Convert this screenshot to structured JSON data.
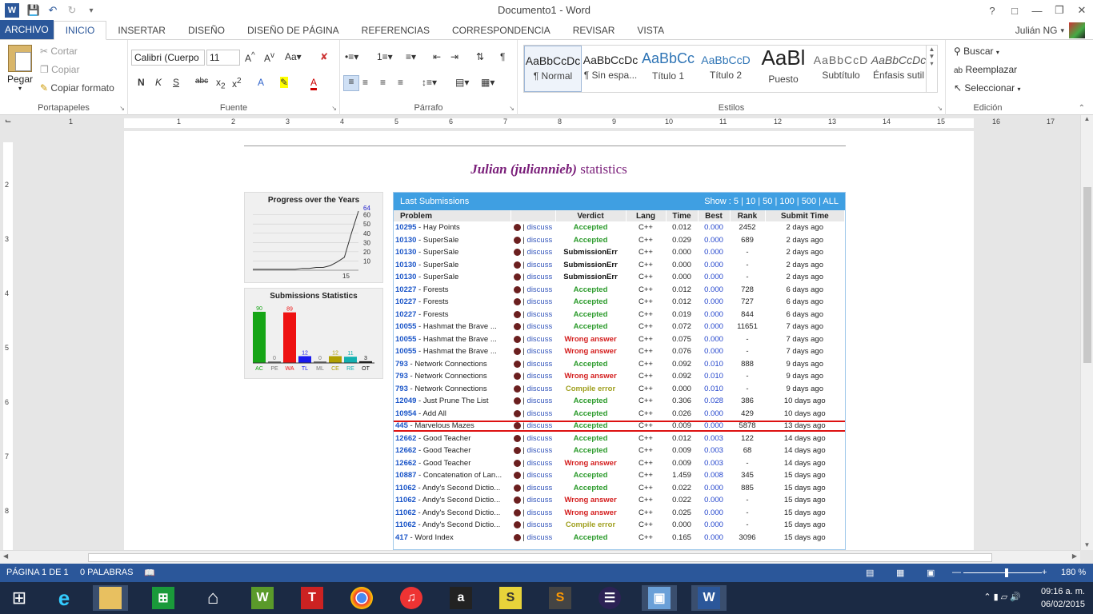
{
  "app": {
    "title": "Documento1 - Word",
    "user": "Julián NG",
    "tabs": [
      "ARCHIVO",
      "INICIO",
      "INSERTAR",
      "DISEÑO",
      "DISEÑO DE PÁGINA",
      "REFERENCIAS",
      "CORRESPONDENCIA",
      "REVISAR",
      "VISTA"
    ],
    "active_tab": "INICIO"
  },
  "ribbon": {
    "clipboard": {
      "group": "Portapapeles",
      "paste": "Pegar",
      "cut": "Cortar",
      "copy": "Copiar",
      "format_painter": "Copiar formato"
    },
    "font": {
      "group": "Fuente",
      "family": "Calibri (Cuerpo",
      "size": "11"
    },
    "paragraph": {
      "group": "Párrafo"
    },
    "styles": {
      "group": "Estilos",
      "items": [
        {
          "preview": "AaBbCcDc",
          "name": "¶ Normal"
        },
        {
          "preview": "AaBbCcDc",
          "name": "¶ Sin espa..."
        },
        {
          "preview": "AaBbCc",
          "name": "Título 1"
        },
        {
          "preview": "AaBbCcD",
          "name": "Título 2"
        },
        {
          "preview": "AaBl",
          "name": "Puesto"
        },
        {
          "preview": "AaBbCcD",
          "name": "Subtítulo"
        },
        {
          "preview": "AaBbCcDc",
          "name": "Énfasis sutil"
        }
      ]
    },
    "editing": {
      "group": "Edición",
      "find": "Buscar",
      "replace": "Reemplazar",
      "select": "Seleccionar"
    }
  },
  "ruler": {
    "numbers": [
      "1",
      "1",
      "2",
      "3",
      "4",
      "5",
      "6",
      "7",
      "8",
      "9",
      "10",
      "11",
      "12",
      "13",
      "14",
      "15",
      "16",
      "17"
    ],
    "vnumbers": [
      "2",
      "3",
      "4",
      "5",
      "6",
      "7",
      "8"
    ]
  },
  "document": {
    "heading_name": "Julian (juliannieb)",
    "heading_rest": " statistics",
    "progress": {
      "title": "Progress over the Years",
      "ticks": [
        "60",
        "50",
        "40",
        "30",
        "20",
        "10"
      ],
      "top_value": "64",
      "x_label": "15"
    },
    "submissions_stats": {
      "title": "Submissions Statistics"
    },
    "last_submissions": {
      "title": "Last Submissions",
      "show": "Show : 5 | 10 | 50 | 100 | 500 | ALL",
      "columns": [
        "Problem",
        "Verdict",
        "Lang",
        "Time",
        "Best",
        "Rank",
        "Submit Time"
      ],
      "discuss_label": "discuss"
    }
  },
  "chart_data": [
    {
      "type": "line",
      "title": "Progress over the Years",
      "x": [
        0,
        1,
        2,
        3,
        4,
        5,
        6,
        7,
        8,
        9,
        10,
        11,
        12,
        13,
        14,
        15
      ],
      "y": [
        1,
        1,
        1,
        1,
        1,
        1,
        1,
        2,
        2,
        3,
        3,
        5,
        9,
        14,
        40,
        64
      ],
      "ylim": [
        0,
        64
      ],
      "xlabel": "15"
    },
    {
      "type": "bar",
      "title": "Submissions Statistics",
      "categories": [
        "AC",
        "PE",
        "WA",
        "TL",
        "ML",
        "CE",
        "RE",
        "OT"
      ],
      "values": [
        90,
        0,
        89,
        12,
        0,
        12,
        11,
        3
      ],
      "colors": [
        "#16a516",
        "#777777",
        "#ee1111",
        "#1a1aee",
        "#777777",
        "#b0a000",
        "#12b0b0",
        "#111111"
      ]
    }
  ],
  "rows": [
    {
      "num": "10295",
      "name": "Hay Points",
      "verdict": "Accepted",
      "vc": "ac",
      "lang": "C++",
      "time": "0.012",
      "best": "0.000",
      "rank": "2452",
      "submit": "2 days ago"
    },
    {
      "num": "10130",
      "name": "SuperSale",
      "verdict": "Accepted",
      "vc": "ac",
      "lang": "C++",
      "time": "0.029",
      "best": "0.000",
      "rank": "689",
      "submit": "2 days ago"
    },
    {
      "num": "10130",
      "name": "SuperSale",
      "verdict": "SubmissionErr",
      "vc": "se",
      "lang": "C++",
      "time": "0.000",
      "best": "0.000",
      "rank": "-",
      "submit": "2 days ago"
    },
    {
      "num": "10130",
      "name": "SuperSale",
      "verdict": "SubmissionErr",
      "vc": "se",
      "lang": "C++",
      "time": "0.000",
      "best": "0.000",
      "rank": "-",
      "submit": "2 days ago"
    },
    {
      "num": "10130",
      "name": "SuperSale",
      "verdict": "SubmissionErr",
      "vc": "se",
      "lang": "C++",
      "time": "0.000",
      "best": "0.000",
      "rank": "-",
      "submit": "2 days ago"
    },
    {
      "num": "10227",
      "name": "Forests",
      "verdict": "Accepted",
      "vc": "ac",
      "lang": "C++",
      "time": "0.012",
      "best": "0.000",
      "rank": "728",
      "submit": "6 days ago"
    },
    {
      "num": "10227",
      "name": "Forests",
      "verdict": "Accepted",
      "vc": "ac",
      "lang": "C++",
      "time": "0.012",
      "best": "0.000",
      "rank": "727",
      "submit": "6 days ago"
    },
    {
      "num": "10227",
      "name": "Forests",
      "verdict": "Accepted",
      "vc": "ac",
      "lang": "C++",
      "time": "0.019",
      "best": "0.000",
      "rank": "844",
      "submit": "6 days ago"
    },
    {
      "num": "10055",
      "name": "Hashmat the Brave ...",
      "verdict": "Accepted",
      "vc": "ac",
      "lang": "C++",
      "time": "0.072",
      "best": "0.000",
      "rank": "11651",
      "submit": "7 days ago"
    },
    {
      "num": "10055",
      "name": "Hashmat the Brave ...",
      "verdict": "Wrong answer",
      "vc": "wa",
      "lang": "C++",
      "time": "0.075",
      "best": "0.000",
      "rank": "-",
      "submit": "7 days ago"
    },
    {
      "num": "10055",
      "name": "Hashmat the Brave ...",
      "verdict": "Wrong answer",
      "vc": "wa",
      "lang": "C++",
      "time": "0.076",
      "best": "0.000",
      "rank": "-",
      "submit": "7 days ago"
    },
    {
      "num": "793",
      "name": "Network Connections",
      "verdict": "Accepted",
      "vc": "ac",
      "lang": "C++",
      "time": "0.092",
      "best": "0.010",
      "rank": "888",
      "submit": "9 days ago"
    },
    {
      "num": "793",
      "name": "Network Connections",
      "verdict": "Wrong answer",
      "vc": "wa",
      "lang": "C++",
      "time": "0.092",
      "best": "0.010",
      "rank": "-",
      "submit": "9 days ago"
    },
    {
      "num": "793",
      "name": "Network Connections",
      "verdict": "Compile error",
      "vc": "ce",
      "lang": "C++",
      "time": "0.000",
      "best": "0.010",
      "rank": "-",
      "submit": "9 days ago"
    },
    {
      "num": "12049",
      "name": "Just Prune The List",
      "verdict": "Accepted",
      "vc": "ac",
      "lang": "C++",
      "time": "0.306",
      "best": "0.028",
      "rank": "386",
      "submit": "10 days ago"
    },
    {
      "num": "10954",
      "name": "Add All",
      "verdict": "Accepted",
      "vc": "ac",
      "lang": "C++",
      "time": "0.026",
      "best": "0.000",
      "rank": "429",
      "submit": "10 days ago"
    },
    {
      "num": "445",
      "name": "Marvelous Mazes",
      "verdict": "Accepted",
      "vc": "ac",
      "lang": "C++",
      "time": "0.009",
      "best": "0.000",
      "rank": "5878",
      "submit": "13 days ago",
      "highlight": true
    },
    {
      "num": "12662",
      "name": "Good Teacher",
      "verdict": "Accepted",
      "vc": "ac",
      "lang": "C++",
      "time": "0.012",
      "best": "0.003",
      "rank": "122",
      "submit": "14 days ago"
    },
    {
      "num": "12662",
      "name": "Good Teacher",
      "verdict": "Accepted",
      "vc": "ac",
      "lang": "C++",
      "time": "0.009",
      "best": "0.003",
      "rank": "68",
      "submit": "14 days ago"
    },
    {
      "num": "12662",
      "name": "Good Teacher",
      "verdict": "Wrong answer",
      "vc": "wa",
      "lang": "C++",
      "time": "0.009",
      "best": "0.003",
      "rank": "-",
      "submit": "14 days ago"
    },
    {
      "num": "10887",
      "name": "Concatenation of Lan...",
      "verdict": "Accepted",
      "vc": "ac",
      "lang": "C++",
      "time": "1.459",
      "best": "0.008",
      "rank": "345",
      "submit": "15 days ago"
    },
    {
      "num": "11062",
      "name": "Andy's Second Dictio...",
      "verdict": "Accepted",
      "vc": "ac",
      "lang": "C++",
      "time": "0.022",
      "best": "0.000",
      "rank": "885",
      "submit": "15 days ago"
    },
    {
      "num": "11062",
      "name": "Andy's Second Dictio...",
      "verdict": "Wrong answer",
      "vc": "wa",
      "lang": "C++",
      "time": "0.022",
      "best": "0.000",
      "rank": "-",
      "submit": "15 days ago"
    },
    {
      "num": "11062",
      "name": "Andy's Second Dictio...",
      "verdict": "Wrong answer",
      "vc": "wa",
      "lang": "C++",
      "time": "0.025",
      "best": "0.000",
      "rank": "-",
      "submit": "15 days ago"
    },
    {
      "num": "11062",
      "name": "Andy's Second Dictio...",
      "verdict": "Compile error",
      "vc": "ce",
      "lang": "C++",
      "time": "0.000",
      "best": "0.000",
      "rank": "-",
      "submit": "15 days ago"
    },
    {
      "num": "417",
      "name": "Word Index",
      "verdict": "Accepted",
      "vc": "ac",
      "lang": "C++",
      "time": "0.165",
      "best": "0.000",
      "rank": "3096",
      "submit": "15 days ago"
    }
  ],
  "status": {
    "page": "PÁGINA 1 DE 1",
    "words": "0 PALABRAS",
    "zoom": "180 %"
  },
  "taskbar": {
    "time": "09:16 a. m.",
    "date": "06/02/2015"
  }
}
